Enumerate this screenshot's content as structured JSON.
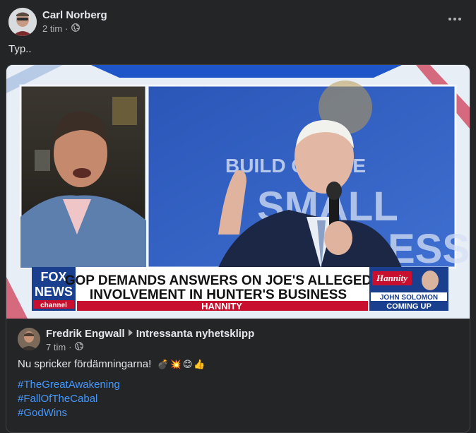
{
  "post": {
    "author": "Carl Norberg",
    "time": "2 tim",
    "separator": "·",
    "text": "Typ.."
  },
  "video": {
    "logo_line1": "FOX",
    "logo_line2": "NEWS",
    "logo_line3": "channel",
    "headline_line1": "GOP DEMANDS ANSWERS ON JOE'S ALLEGED",
    "headline_line2": "INVOLVEMENT IN HUNTER'S BUSINESS",
    "show_name": "HANNITY",
    "promo_brand": "Hannity",
    "promo_guest": "JOHN SOLOMON",
    "promo_tag": "COMING UP",
    "backdrop_words_1": "BUILD ON THE",
    "backdrop_words_2": "SMALL",
    "backdrop_words_3": "ESS"
  },
  "shared": {
    "author": "Fredrik Engwall",
    "group": "Intressanta nyhetsklipp",
    "time": "7 tim",
    "separator": "·",
    "text": "Nu spricker fördämningarna!",
    "emojis": [
      "💣",
      "💥",
      "😊",
      "👍"
    ],
    "hashtags": [
      "#TheGreatAwakening",
      "#FallOfTheCabal",
      "#GodWins"
    ]
  },
  "colors": {
    "background": "#242526",
    "text_primary": "#e4e6eb",
    "text_secondary": "#b0b3b8",
    "link": "#4599ff",
    "fox_red": "#c8102e",
    "fox_blue": "#1b3f8f"
  }
}
